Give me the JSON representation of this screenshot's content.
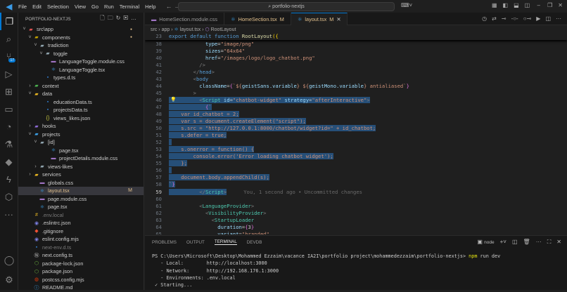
{
  "menu": [
    "File",
    "Edit",
    "Selection",
    "View",
    "Go",
    "Run",
    "Terminal",
    "Help"
  ],
  "search": "portfolio-nextjs",
  "explorer": {
    "title": "PORTFOLIO-NEXTJS",
    "items": [
      {
        "label": "src\\app",
        "indent": 0,
        "chev": "v",
        "icon": "folder",
        "color": "#e05252",
        "dot": true
      },
      {
        "label": "components",
        "indent": 1,
        "chev": "v",
        "icon": "folder",
        "color": "#c0a000",
        "dot": true
      },
      {
        "label": "tradiction",
        "indent": 2,
        "chev": "v",
        "icon": "folder",
        "color": "#90a4ae"
      },
      {
        "label": "toggle",
        "indent": 3,
        "chev": "v",
        "icon": "folder",
        "color": "#90a4ae"
      },
      {
        "label": "LanguageToggle.module.css",
        "indent": 4,
        "icon": "css",
        "color": "#a074c4"
      },
      {
        "label": "LanguageToggle.tsx",
        "indent": 4,
        "icon": "react",
        "color": "#3ba0e6"
      },
      {
        "label": "types.d.ts",
        "indent": 3,
        "icon": "ts",
        "color": "#3178c6"
      },
      {
        "label": "context",
        "indent": 1,
        "chev": ">",
        "icon": "folder",
        "color": "#4caf50"
      },
      {
        "label": "data",
        "indent": 1,
        "chev": "v",
        "icon": "folder",
        "color": "#e6b422"
      },
      {
        "label": "educationData.ts",
        "indent": 3,
        "icon": "ts",
        "color": "#3178c6"
      },
      {
        "label": "projectsData.ts",
        "indent": 3,
        "icon": "ts",
        "color": "#3178c6"
      },
      {
        "label": "views_likes.json",
        "indent": 3,
        "icon": "json",
        "color": "#cbcb41"
      },
      {
        "label": "hooks",
        "indent": 1,
        "chev": ">",
        "icon": "folder",
        "color": "#8e6bd6"
      },
      {
        "label": "projects",
        "indent": 1,
        "chev": "v",
        "icon": "folder",
        "color": "#3ba0e6"
      },
      {
        "label": "[id]",
        "indent": 2,
        "chev": "v",
        "icon": "folder",
        "color": "#90a4ae"
      },
      {
        "label": "page.tsx",
        "indent": 4,
        "icon": "react",
        "color": "#3ba0e6"
      },
      {
        "label": "projectDetails.module.css",
        "indent": 4,
        "icon": "css",
        "color": "#a074c4"
      },
      {
        "label": "views-likes",
        "indent": 2,
        "chev": ">",
        "icon": "folder",
        "color": "#90a4ae"
      },
      {
        "label": "services",
        "indent": 1,
        "chev": ">",
        "icon": "folder",
        "color": "#e6b422"
      },
      {
        "label": "globals.css",
        "indent": 2,
        "icon": "css",
        "color": "#a074c4"
      },
      {
        "label": "layout.tsx",
        "indent": 2,
        "icon": "react",
        "color": "#3ba0e6",
        "selected": true,
        "badge": "M"
      },
      {
        "label": "page.module.css",
        "indent": 2,
        "icon": "css",
        "color": "#a074c4"
      },
      {
        "label": "page.tsx",
        "indent": 2,
        "icon": "react",
        "color": "#3ba0e6"
      },
      {
        "label": ".env.local",
        "indent": 1,
        "icon": "env",
        "color": "#e6b422",
        "dim": true
      },
      {
        "label": ".eslintrc.json",
        "indent": 1,
        "icon": "eslint",
        "color": "#7b7fe0"
      },
      {
        "label": ".gitignore",
        "indent": 1,
        "icon": "git",
        "color": "#f05033"
      },
      {
        "label": "eslint.config.mjs",
        "indent": 1,
        "icon": "eslint",
        "color": "#7b7fe0"
      },
      {
        "label": "next-env.d.ts",
        "indent": 1,
        "icon": "ts",
        "color": "#3178c6",
        "dim": true
      },
      {
        "label": "next.config.ts",
        "indent": 1,
        "icon": "next",
        "color": "#ddd"
      },
      {
        "label": "package-lock.json",
        "indent": 1,
        "icon": "npm",
        "color": "#6cb33f"
      },
      {
        "label": "package.json",
        "indent": 1,
        "icon": "npm",
        "color": "#6cb33f"
      },
      {
        "label": "postcss.config.mjs",
        "indent": 1,
        "icon": "postcss",
        "color": "#dd3a0a"
      },
      {
        "label": "README.md",
        "indent": 1,
        "icon": "info",
        "color": "#3ba0e6"
      }
    ]
  },
  "tabs": [
    {
      "label": "HomeSection.module.css",
      "icon": "css",
      "color": "#a074c4"
    },
    {
      "label": "HomeSection.tsx",
      "badge": "M",
      "icon": "react",
      "color": "#3ba0e6",
      "mod": true
    },
    {
      "label": "layout.tsx",
      "badge": "M",
      "icon": "react",
      "color": "#3ba0e6",
      "active": true
    }
  ],
  "breadcrumb": [
    "src",
    "app",
    "layout.tsx",
    "RootLayout"
  ],
  "code": {
    "sticky": {
      "n": "23",
      "segs": [
        [
          "k",
          "export default function "
        ],
        [
          "f",
          "RootLayout"
        ],
        [
          "br",
          "({"
        ]
      ]
    },
    "lines": [
      {
        "n": "38",
        "segs": [
          [
            "p",
            "            "
          ],
          [
            "v",
            "type"
          ],
          [
            "p",
            "="
          ],
          [
            "str",
            "\"image/png\""
          ]
        ]
      },
      {
        "n": "39",
        "segs": [
          [
            "p",
            "            "
          ],
          [
            "v",
            "sizes"
          ],
          [
            "p",
            "="
          ],
          [
            "str",
            "\"64x64\""
          ]
        ]
      },
      {
        "n": "40",
        "segs": [
          [
            "p",
            "            "
          ],
          [
            "v",
            "href"
          ],
          [
            "p",
            "="
          ],
          [
            "str",
            "\"/images/logo/logo_chatbot.png\""
          ]
        ]
      },
      {
        "n": "41",
        "segs": [
          [
            "p",
            "          "
          ],
          [
            "tg",
            "/>"
          ]
        ]
      },
      {
        "n": "42",
        "segs": [
          [
            "p",
            "        "
          ],
          [
            "tg",
            "</"
          ],
          [
            "k",
            "head"
          ],
          [
            "tg",
            ">"
          ]
        ]
      },
      {
        "n": "43",
        "segs": [
          [
            "p",
            "        "
          ],
          [
            "tg",
            "<"
          ],
          [
            "k",
            "body"
          ]
        ]
      },
      {
        "n": "44",
        "segs": [
          [
            "p",
            "          "
          ],
          [
            "v",
            "className"
          ],
          [
            "p",
            "="
          ],
          [
            "pu",
            "{"
          ],
          [
            "str",
            "`${"
          ],
          [
            "v",
            "geistSans.variable"
          ],
          [
            "str",
            "} ${"
          ],
          [
            "v",
            "geistMono.variable"
          ],
          [
            "str",
            "} antialiased`"
          ],
          [
            "pu",
            "}"
          ]
        ]
      },
      {
        "n": "45",
        "segs": [
          [
            "p",
            "        "
          ],
          [
            "tg",
            ">"
          ]
        ]
      },
      {
        "n": "46",
        "sel": true,
        "segs": [
          [
            "p",
            "          "
          ],
          [
            "tg",
            "<"
          ],
          [
            "t",
            "Script"
          ],
          [
            "v",
            " id"
          ],
          [
            "p",
            "="
          ],
          [
            "str",
            "\"chatbot-widget\""
          ],
          [
            "v",
            " strategy"
          ],
          [
            "p",
            "="
          ],
          [
            "str",
            "\"afterInteractive\""
          ],
          [
            "tg",
            ">"
          ]
        ]
      },
      {
        "n": "47",
        "sel": true,
        "segs": [
          [
            "p",
            "            "
          ],
          [
            "pu",
            "{"
          ],
          [
            "str",
            "`"
          ]
        ]
      },
      {
        "n": "48",
        "sel": true,
        "segs": [
          [
            "str",
            "    var id_chatbot = 2;"
          ]
        ]
      },
      {
        "n": "49",
        "sel": true,
        "segs": [
          [
            "str",
            "    var s = document.createElement(\"script\");"
          ]
        ]
      },
      {
        "n": "50",
        "sel": true,
        "segs": [
          [
            "str",
            "    s.src = \"http://127.0.0.1:8000/chatbot/widget?id=\" + id_chatbot;"
          ]
        ]
      },
      {
        "n": "51",
        "sel": true,
        "segs": [
          [
            "str",
            "    s.defer = true;"
          ]
        ]
      },
      {
        "n": "52",
        "sel": true,
        "segs": [
          [
            "str",
            " "
          ]
        ]
      },
      {
        "n": "53",
        "sel": true,
        "segs": [
          [
            "str",
            "    s.onerror = function() {"
          ]
        ]
      },
      {
        "n": "54",
        "sel": true,
        "segs": [
          [
            "str",
            "        console.error('Error loading chatbot widget');"
          ]
        ]
      },
      {
        "n": "55",
        "sel": true,
        "segs": [
          [
            "str",
            "    };"
          ]
        ]
      },
      {
        "n": "56",
        "sel": true,
        "segs": [
          [
            "str",
            " "
          ]
        ]
      },
      {
        "n": "57",
        "sel": true,
        "segs": [
          [
            "str",
            "    document.body.appendChild(s);"
          ]
        ]
      },
      {
        "n": "58",
        "sel": true,
        "segs": [
          [
            "str",
            "`"
          ],
          [
            "pu",
            "}"
          ]
        ]
      },
      {
        "n": "59",
        "sel": true,
        "cur": true,
        "segs": [
          [
            "p",
            "          "
          ],
          [
            "tg",
            "</"
          ],
          [
            "t",
            "Script"
          ],
          [
            "tg",
            ">"
          ]
        ],
        "blame": "You, 1 second ago • Uncommitted changes"
      },
      {
        "n": "60",
        "segs": [
          [
            "p",
            " "
          ]
        ]
      },
      {
        "n": "61",
        "segs": [
          [
            "p",
            "          "
          ],
          [
            "tg",
            "<"
          ],
          [
            "t",
            "LanguageProvider"
          ],
          [
            "tg",
            ">"
          ]
        ]
      },
      {
        "n": "62",
        "segs": [
          [
            "p",
            "            "
          ],
          [
            "tg",
            "<"
          ],
          [
            "t",
            "VisibilityProvider"
          ],
          [
            "tg",
            ">"
          ]
        ]
      },
      {
        "n": "63",
        "segs": [
          [
            "p",
            "              "
          ],
          [
            "tg",
            "<"
          ],
          [
            "t",
            "StartupLoader"
          ]
        ]
      },
      {
        "n": "64",
        "segs": [
          [
            "p",
            "                "
          ],
          [
            "v",
            "duration"
          ],
          [
            "p",
            "="
          ],
          [
            "pu",
            "{"
          ],
          [
            "p",
            "3"
          ],
          [
            "pu",
            "}"
          ]
        ]
      },
      {
        "n": "65",
        "segs": [
          [
            "p",
            "                "
          ],
          [
            "v",
            "variant"
          ],
          [
            "p",
            "="
          ],
          [
            "str",
            "\"branded\""
          ]
        ]
      }
    ]
  },
  "panel": {
    "tabs": [
      "PROBLEMS",
      "OUTPUT",
      "TERMINAL",
      "DEVDB"
    ],
    "active": 2,
    "shell": "node",
    "terminal": {
      "prompt": "PS C:\\Users\\Microsoft\\Desktop\\Mohammed Ezzaim\\vacance IA2I\\portfolio project\\mohammedezzaim\\portfolio-nextjs> ",
      "cmd": "npm",
      "args": " run dev",
      "lines": [
        "   - Local:        http://localhost:3000",
        "   - Network:      http://192.168.176.1:3000",
        "   - Environments: .env.local",
        " ✓ Starting..."
      ]
    }
  }
}
